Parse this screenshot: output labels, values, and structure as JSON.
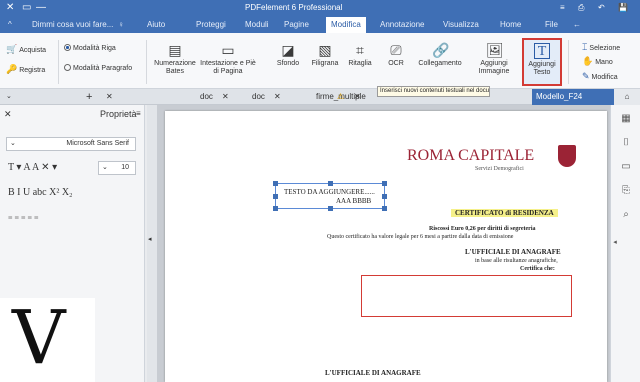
{
  "app": {
    "title": "PDFelement 6 Professional"
  },
  "window_buttons": {
    "minimize": "—",
    "restore": "▭",
    "close": "✕"
  },
  "title_icons": {
    "save": "💾",
    "undo": "↶",
    "print": "⎙",
    "more": "≡"
  },
  "menu": {
    "items": [
      "File",
      "Home",
      "Visualizza",
      "Annotazione",
      "Modifica",
      "Pagine",
      "Moduli",
      "Proteggi",
      "Aiuto"
    ],
    "search_label": "Dimmi cosa vuoi fare...",
    "active": "Modifica"
  },
  "ribbon": {
    "tools": {
      "selection": "Selezione",
      "hand": "Mano",
      "edit": "Modifica"
    },
    "buttons": {
      "add_text": "Aggiungi Testo",
      "add_image": "Aggiungi Immagine",
      "link": "Collegamento",
      "ocr": "OCR",
      "crop": "Ritaglia",
      "watermark": "Filigrana",
      "background": "Sfondo",
      "header_footer": "Intestazione e Piè di Pagina",
      "bates": "Numerazione Bates"
    },
    "modes": {
      "line_mode": "Modalità Riga",
      "paragraph_mode": "Modalità Paragrafo"
    },
    "store": {
      "buy": "Acquista",
      "register": "Registra"
    }
  },
  "tooltip": "Inserisci nuovi contenuti testuali nel documento",
  "tabs": {
    "items": [
      "Modello_F24",
      "firme_multiple",
      "doc",
      "doc"
    ],
    "new_tab": "+"
  },
  "properties": {
    "title": "Proprietà",
    "font_name": "Microsoft Sans Serif",
    "font_size": "10",
    "format_row1": "T  ▾  A  A  ✕  ▾",
    "format_row2": "B  I  U  abc  X²  X₂"
  },
  "document": {
    "org_name": "ROMA CAPITALE",
    "org_sub": "Servizi Demografici",
    "inserted_text_line1": "TESTO DA AGGIUNGERE......",
    "inserted_text_line2": "AAA  BBBB",
    "cert_title": "CERTIFICATO di RESIDENZA",
    "line_fees": "Riscossi Euro 0,26 per diritti di segreteria",
    "line_validity": "Questo certificato ha valore legale per 6 mesi a partire dalla data di emissione",
    "officer_title": "L'UFFICIALE DI ANAGRAFE",
    "line_records": "in base alle risultanze anagrafiche,",
    "line_certifies": "Certifica che:",
    "footer_officer": "L'UFFICIALE DI ANAGRAFE"
  },
  "colors": {
    "brand": "#3f6fb5",
    "highlight_border": "#d33b35",
    "doc_title": "#9b2335",
    "cert_highlight": "#f5f08a"
  }
}
